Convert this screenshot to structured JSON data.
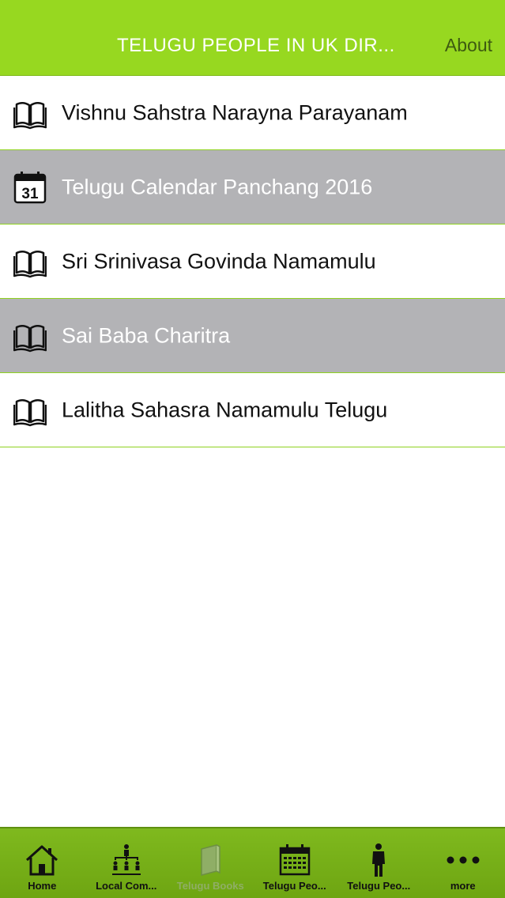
{
  "header": {
    "title": "TELUGU PEOPLE IN UK DIR...",
    "about_label": "About"
  },
  "list": {
    "items": [
      {
        "label": "Vishnu Sahstra Narayna Parayanam",
        "icon": "book-icon",
        "style": "white"
      },
      {
        "label": "Telugu Calendar Panchang 2016",
        "icon": "calendar-icon",
        "calendar_day": "31",
        "style": "grey"
      },
      {
        "label": "Sri Srinivasa Govinda Namamulu",
        "icon": "book-icon",
        "style": "white"
      },
      {
        "label": "Sai Baba Charitra",
        "icon": "book-icon",
        "style": "grey"
      },
      {
        "label": "Lalitha Sahasra Namamulu Telugu",
        "icon": "book-icon",
        "style": "white"
      }
    ]
  },
  "tabbar": {
    "tabs": [
      {
        "label": "Home",
        "icon": "home-icon"
      },
      {
        "label": "Local Com...",
        "icon": "org-chart-icon"
      },
      {
        "label": "Telugu Books",
        "icon": "closed-book-icon",
        "selected": true
      },
      {
        "label": "Telugu Peo...",
        "icon": "calendar-grid-icon"
      },
      {
        "label": "Telugu Peo...",
        "icon": "person-icon"
      },
      {
        "label": "more",
        "icon": "more-dots-icon"
      }
    ]
  },
  "colors": {
    "accent": "#97d820",
    "tabbar": "#77b018",
    "row_grey": "#b3b3b6",
    "divider": "#8fd21f"
  }
}
